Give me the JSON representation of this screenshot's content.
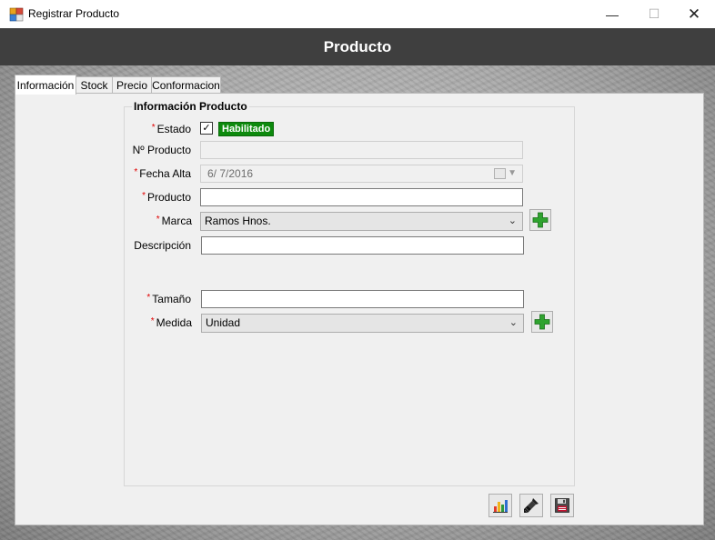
{
  "window": {
    "title": "Registrar Producto",
    "icon": "app-window-icon",
    "controls": {
      "minimize": "—",
      "maximize": "☐",
      "close": "✕"
    }
  },
  "header": {
    "title": "Producto"
  },
  "tabs": [
    {
      "label": "Información",
      "active": true
    },
    {
      "label": "Stock",
      "active": false
    },
    {
      "label": "Precio",
      "active": false
    },
    {
      "label": "Conformacion",
      "active": false
    }
  ],
  "group": {
    "title": "Información Producto",
    "required_mark": "*",
    "fields": {
      "estado": {
        "label": "Estado",
        "checked": true,
        "check_glyph": "✓",
        "badge": "Habilitado",
        "badge_color": "#0d8a0d"
      },
      "nro_producto": {
        "label": "Nº Producto",
        "value": ""
      },
      "fecha_alta": {
        "label": "Fecha Alta",
        "value": "6/  7/2016"
      },
      "producto": {
        "label": "Producto",
        "value": ""
      },
      "marca": {
        "label": "Marca",
        "value": "Ramos Hnos."
      },
      "descripcion": {
        "label": "Descripción",
        "value": ""
      },
      "tamano": {
        "label": "Tamaño",
        "value": ""
      },
      "medida": {
        "label": "Medida",
        "value": "Unidad"
      }
    }
  },
  "toolbar": {
    "report_icon": "bar-chart-icon",
    "clear_icon": "brush-icon",
    "save_icon": "floppy-disk-icon"
  },
  "colors": {
    "header_bg": "#3f3f3f",
    "required": "#e00000",
    "add_green": "#2fa32f"
  }
}
